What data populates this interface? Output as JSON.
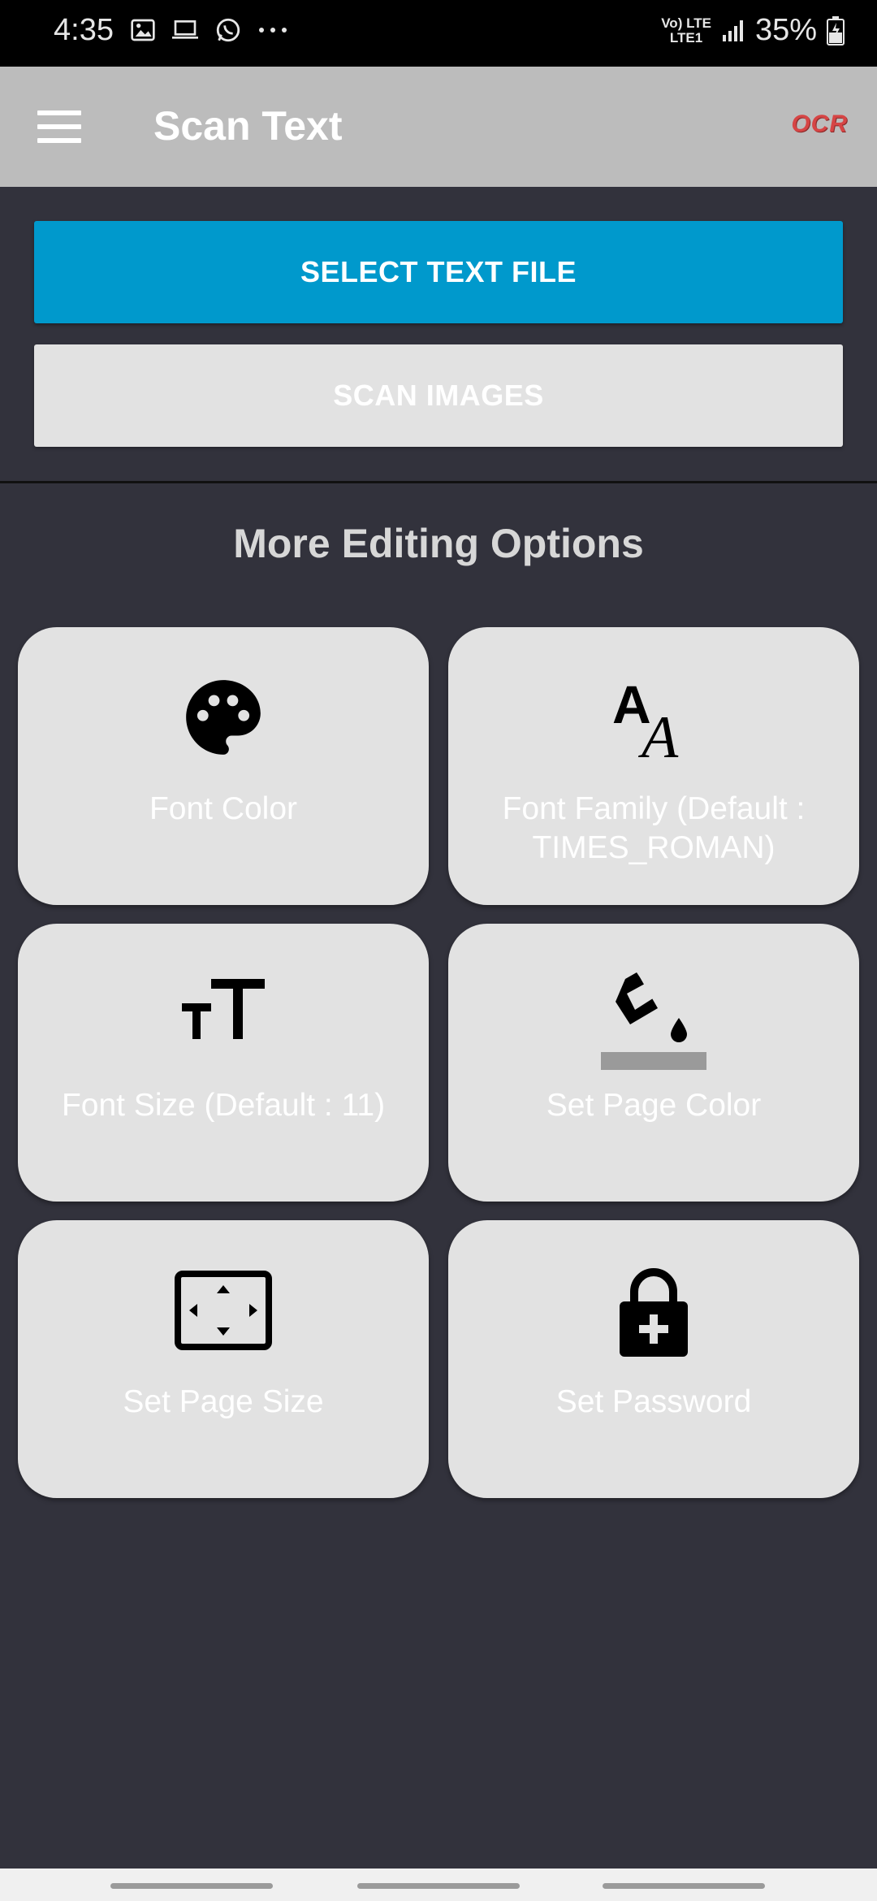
{
  "status_bar": {
    "time": "4:35",
    "network_top": "Vo) LTE",
    "network_bottom": "LTE1",
    "battery": "35%"
  },
  "app_bar": {
    "title": "Scan Text",
    "logo": "OCR"
  },
  "actions": {
    "select_text_file": "SELECT TEXT FILE",
    "scan_images": "SCAN IMAGES"
  },
  "section_title": "More Editing Options",
  "options": [
    {
      "label": "Font Color",
      "icon": "palette-icon"
    },
    {
      "label": "Font Family (Default : TIMES_ROMAN)",
      "icon": "font-family-icon"
    },
    {
      "label": "Font Size (Default : 11)",
      "icon": "font-size-icon"
    },
    {
      "label": "Set Page Color",
      "icon": "paint-bucket-icon"
    },
    {
      "label": "Set Page Size",
      "icon": "page-size-icon"
    },
    {
      "label": "Set Password",
      "icon": "lock-icon"
    }
  ],
  "colors": {
    "primary_button": "#0099cc",
    "background": "#32323c",
    "app_bar": "#bcbcbc",
    "card": "#e2e2e2"
  }
}
